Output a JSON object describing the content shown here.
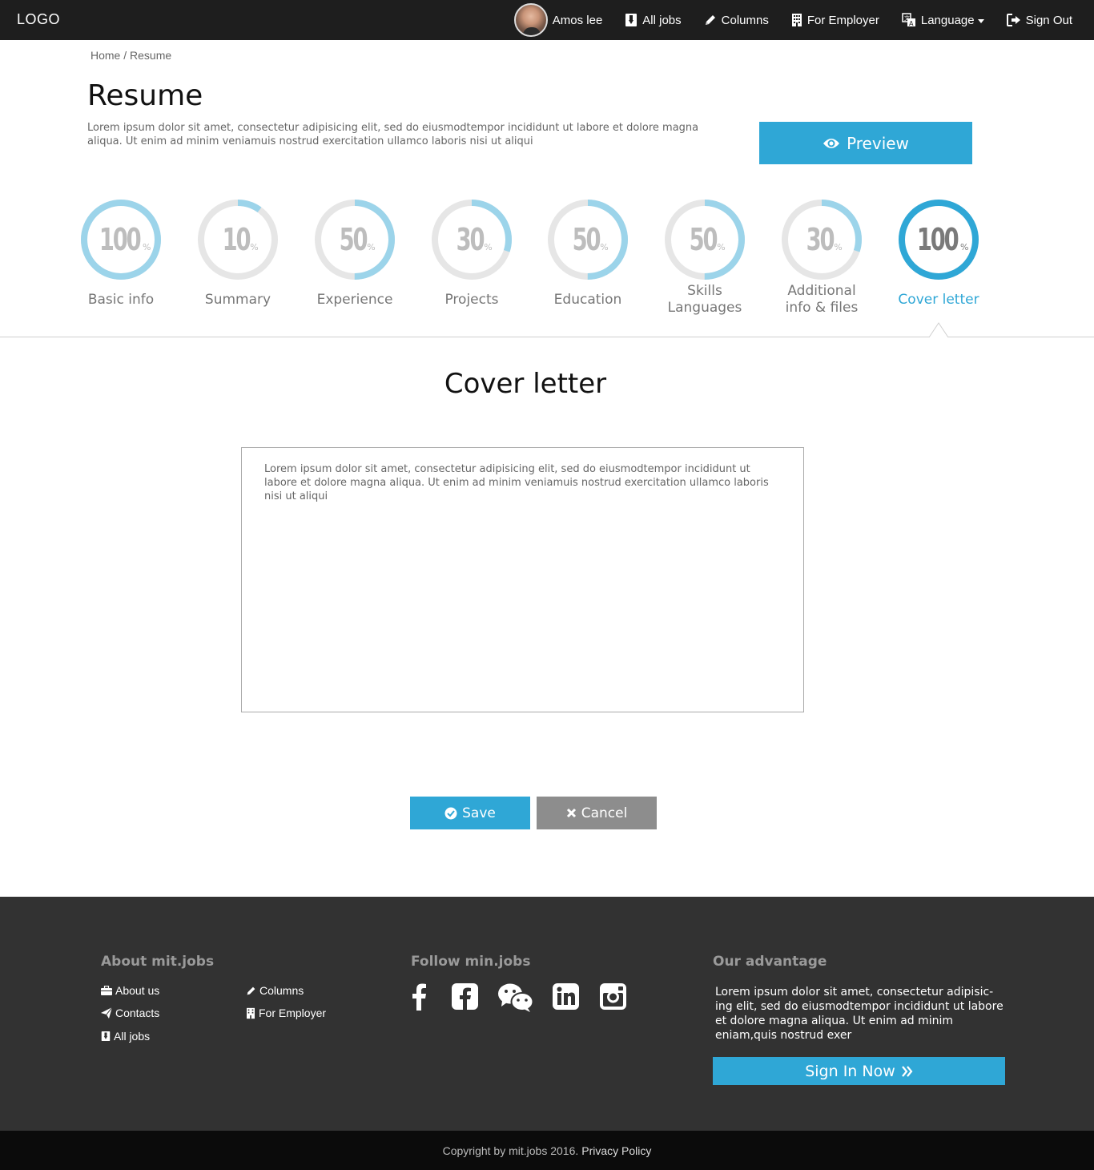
{
  "navbar": {
    "logo": "LOGO",
    "user_name": "Amos lee",
    "items": [
      {
        "label": "All jobs",
        "icon": "badge-icon"
      },
      {
        "label": "Columns",
        "icon": "pencil-icon"
      },
      {
        "label": "For Employer",
        "icon": "building-icon"
      },
      {
        "label": "Language",
        "icon": "translate-icon"
      },
      {
        "label": "Sign Out",
        "icon": "sign-out-icon"
      }
    ]
  },
  "breadcrumb": {
    "home": "Home",
    "separator": " / ",
    "current": "Resume"
  },
  "page": {
    "title": "Resume",
    "intro": "Lorem ipsum dolor sit amet, consectetur adipisicing elit, sed do eiusmodtempor incididunt ut labore et dolore magna aliqua. Ut enim ad minim veniamuis nostrud exercitation ullamco laboris nisi ut aliqui",
    "preview_label": "Preview"
  },
  "steps": [
    {
      "percent": 100,
      "percent_text": "100",
      "label_lines": [
        "Basic info"
      ],
      "active": false
    },
    {
      "percent": 10,
      "percent_text": "10",
      "label_lines": [
        "Summary"
      ],
      "active": false
    },
    {
      "percent": 50,
      "percent_text": "50",
      "label_lines": [
        "Experience"
      ],
      "active": false
    },
    {
      "percent": 30,
      "percent_text": "30",
      "label_lines": [
        "Projects"
      ],
      "active": false
    },
    {
      "percent": 50,
      "percent_text": "50",
      "label_lines": [
        "Education"
      ],
      "active": false
    },
    {
      "percent": 50,
      "percent_text": "50",
      "label_lines": [
        "Skills",
        "Languages"
      ],
      "active": false
    },
    {
      "percent": 30,
      "percent_text": "30",
      "label_lines": [
        "Additional",
        "info & files"
      ],
      "active": false
    },
    {
      "percent": 100,
      "percent_text": "100",
      "label_lines": [
        "Cover letter"
      ],
      "active": true
    }
  ],
  "percent_sign": "%",
  "cover_letter": {
    "title": "Cover letter",
    "text": "Lorem ipsum dolor sit amet, consectetur adipisicing elit, sed do eiusmodtempor incididunt ut labore et dolore magna aliqua. Ut enim ad minim veniamuis nostrud exercitation ullamco laboris nisi ut aliqui",
    "save_label": "Save",
    "cancel_label": "Cancel"
  },
  "footer": {
    "about_heading": "About mit.jobs",
    "about_links": {
      "about_us": "About us",
      "columns": "Columns",
      "contacts": "Contacts",
      "for_employer": "For Employer",
      "all_jobs": "All jobs"
    },
    "follow_heading": "Follow min.jobs",
    "social": [
      "facebook-icon",
      "facebook-square-icon",
      "wechat-icon",
      "linkedin-icon",
      "instagram-icon"
    ],
    "advantage_heading": "Our advantage",
    "advantage_text": "Lorem ipsum dolor sit amet, consectetur adipisic-ing elit, sed do eiusmodtempor incididunt ut labore et dolore magna aliqua. Ut enim ad minim eniam,quis nostrud exer",
    "signin_label": "Sign In Now",
    "copyright": "Copyright by mit.jobs 2016.",
    "privacy": "Privacy Policy"
  },
  "colors": {
    "accent": "#2fa7d6",
    "ring_light": "#9cd4ea",
    "ring_track": "#e6e6e6",
    "navbar_bg": "#1e1e1e",
    "footer_bg": "#323232",
    "copyright_bg": "#0b0b0b",
    "cancel_bg": "#8d8d8d"
  }
}
